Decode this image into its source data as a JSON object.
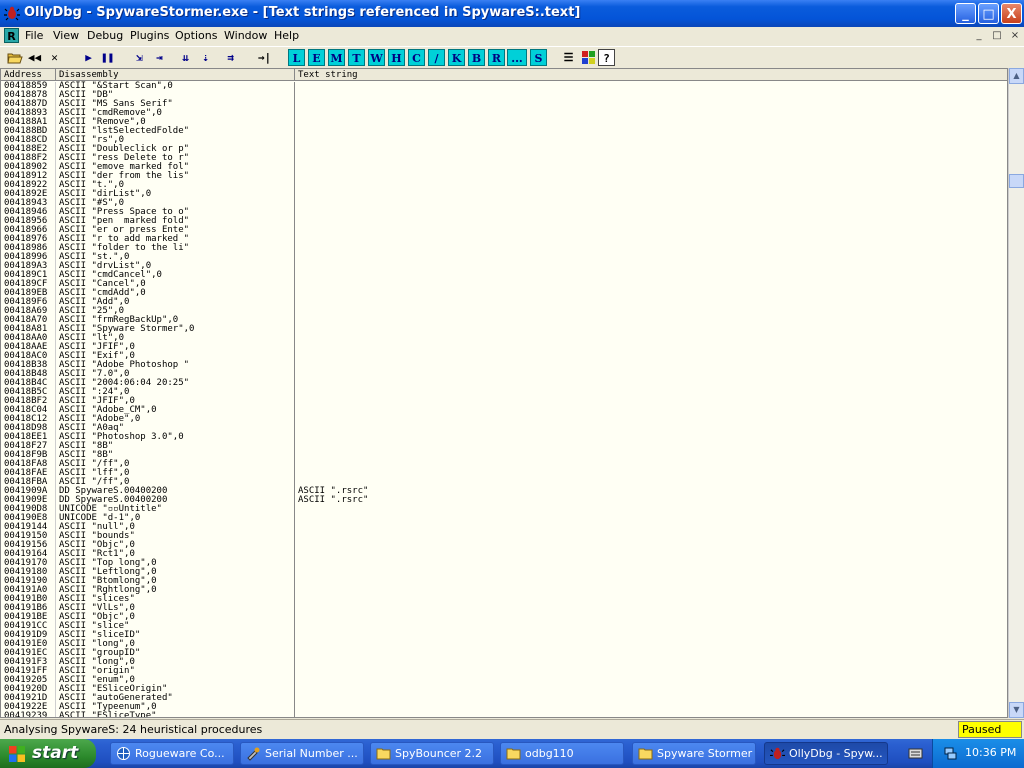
{
  "window": {
    "title": "OllyDbg - SpywareStormer.exe - [Text strings referenced in SpywareS:.text]",
    "controls": {
      "minimize": "_",
      "maximize": "□",
      "close": "X"
    }
  },
  "menu": {
    "items": [
      "File",
      "View",
      "Debug",
      "Plugins",
      "Options",
      "Window",
      "Help"
    ],
    "mdi_controls": [
      "_",
      "□",
      "×"
    ]
  },
  "toolbar": {
    "letters": [
      "L",
      "E",
      "M",
      "T",
      "W",
      "H",
      "C",
      "/",
      "K",
      "B",
      "R",
      "...",
      "S"
    ],
    "icons": [
      "open-icon",
      "restart-icon",
      "close-program-icon",
      "run-icon",
      "pause-icon",
      "step-into-icon",
      "step-over-icon",
      "trace-into-icon",
      "trace-over-icon",
      "execute-till-return-icon",
      "goto-icon",
      "list-icon",
      "colors-icon",
      "help-icon"
    ]
  },
  "columns": {
    "address": "Address",
    "disassembly": "Disassembly",
    "text": "Text string"
  },
  "rows": [
    {
      "addr": "00418859",
      "dis": "ASCII \"&Start Scan\",0",
      "txt": ""
    },
    {
      "addr": "00418878",
      "dis": "ASCII \"DB\"",
      "txt": ""
    },
    {
      "addr": "0041887D",
      "dis": "ASCII \"MS Sans Serif\"",
      "txt": ""
    },
    {
      "addr": "00418893",
      "dis": "ASCII \"cmdRemove\",0",
      "txt": ""
    },
    {
      "addr": "004188A1",
      "dis": "ASCII \"Remove\",0",
      "txt": ""
    },
    {
      "addr": "004188BD",
      "dis": "ASCII \"lstSelectedFolde\"",
      "txt": ""
    },
    {
      "addr": "004188CD",
      "dis": "ASCII \"rs\",0",
      "txt": ""
    },
    {
      "addr": "004188E2",
      "dis": "ASCII \"Doubleclick or p\"",
      "txt": ""
    },
    {
      "addr": "004188F2",
      "dis": "ASCII \"ress Delete to r\"",
      "txt": ""
    },
    {
      "addr": "00418902",
      "dis": "ASCII \"emove marked fol\"",
      "txt": ""
    },
    {
      "addr": "00418912",
      "dis": "ASCII \"der from the lis\"",
      "txt": ""
    },
    {
      "addr": "00418922",
      "dis": "ASCII \"t.\",0",
      "txt": ""
    },
    {
      "addr": "0041892E",
      "dis": "ASCII \"dirList\",0",
      "txt": ""
    },
    {
      "addr": "00418943",
      "dis": "ASCII \"#S\",0",
      "txt": ""
    },
    {
      "addr": "00418946",
      "dis": "ASCII \"Press Space to o\"",
      "txt": ""
    },
    {
      "addr": "00418956",
      "dis": "ASCII \"pen  marked fold\"",
      "txt": ""
    },
    {
      "addr": "00418966",
      "dis": "ASCII \"er or press Ente\"",
      "txt": ""
    },
    {
      "addr": "00418976",
      "dis": "ASCII \"r to add marked \"",
      "txt": ""
    },
    {
      "addr": "00418986",
      "dis": "ASCII \"folder to the li\"",
      "txt": ""
    },
    {
      "addr": "00418996",
      "dis": "ASCII \"st.\",0",
      "txt": ""
    },
    {
      "addr": "004189A3",
      "dis": "ASCII \"drvList\",0",
      "txt": ""
    },
    {
      "addr": "004189C1",
      "dis": "ASCII \"cmdCancel\",0",
      "txt": ""
    },
    {
      "addr": "004189CF",
      "dis": "ASCII \"Cancel\",0",
      "txt": ""
    },
    {
      "addr": "004189EB",
      "dis": "ASCII \"cmdAdd\",0",
      "txt": ""
    },
    {
      "addr": "004189F6",
      "dis": "ASCII \"Add\",0",
      "txt": ""
    },
    {
      "addr": "00418A69",
      "dis": "ASCII \"25\",0",
      "txt": ""
    },
    {
      "addr": "00418A70",
      "dis": "ASCII \"frmRegBackUp\",0",
      "txt": ""
    },
    {
      "addr": "00418A81",
      "dis": "ASCII \"Spyware Stormer\",0",
      "txt": ""
    },
    {
      "addr": "00418AA0",
      "dis": "ASCII \"lt\",0",
      "txt": ""
    },
    {
      "addr": "00418AAE",
      "dis": "ASCII \"JFIF\",0",
      "txt": ""
    },
    {
      "addr": "00418AC0",
      "dis": "ASCII \"Exif\",0",
      "txt": ""
    },
    {
      "addr": "00418B38",
      "dis": "ASCII \"Adobe Photoshop \"",
      "txt": ""
    },
    {
      "addr": "00418B48",
      "dis": "ASCII \"7.0\",0",
      "txt": ""
    },
    {
      "addr": "00418B4C",
      "dis": "ASCII \"2004:06:04 20:25\"",
      "txt": ""
    },
    {
      "addr": "00418B5C",
      "dis": "ASCII \":24\",0",
      "txt": ""
    },
    {
      "addr": "00418BF2",
      "dis": "ASCII \"JFIF\",0",
      "txt": ""
    },
    {
      "addr": "00418C04",
      "dis": "ASCII \"Adobe_CM\",0",
      "txt": ""
    },
    {
      "addr": "00418C12",
      "dis": "ASCII \"Adobe\",0",
      "txt": ""
    },
    {
      "addr": "00418D98",
      "dis": "ASCII \"A0aq\"",
      "txt": ""
    },
    {
      "addr": "00418EE1",
      "dis": "ASCII \"Photoshop 3.0\",0",
      "txt": ""
    },
    {
      "addr": "00418F27",
      "dis": "ASCII \"8B\"",
      "txt": ""
    },
    {
      "addr": "00418F9B",
      "dis": "ASCII \"8B\"",
      "txt": ""
    },
    {
      "addr": "00418FA8",
      "dis": "ASCII \"/ff\",0",
      "txt": ""
    },
    {
      "addr": "00418FAE",
      "dis": "ASCII \"lff\",0",
      "txt": ""
    },
    {
      "addr": "00418FBA",
      "dis": "ASCII \"/ff\",0",
      "txt": ""
    },
    {
      "addr": "0041909A",
      "dis": "DD SpywareS.00400200",
      "txt": "ASCII \".rsrc\""
    },
    {
      "addr": "0041909E",
      "dis": "DD SpywareS.00400200",
      "txt": "ASCII \".rsrc\""
    },
    {
      "addr": "004190D8",
      "dis": "UNICODE \"▫▫Untitle\"",
      "txt": ""
    },
    {
      "addr": "004190E8",
      "dis": "UNICODE \"d-1\",0",
      "txt": ""
    },
    {
      "addr": "00419144",
      "dis": "ASCII \"null\",0",
      "txt": ""
    },
    {
      "addr": "00419150",
      "dis": "ASCII \"bounds\"",
      "txt": ""
    },
    {
      "addr": "00419156",
      "dis": "ASCII \"Objc\",0",
      "txt": ""
    },
    {
      "addr": "00419164",
      "dis": "ASCII \"Rct1\",0",
      "txt": ""
    },
    {
      "addr": "00419170",
      "dis": "ASCII \"Top long\",0",
      "txt": ""
    },
    {
      "addr": "00419180",
      "dis": "ASCII \"Leftlong\",0",
      "txt": ""
    },
    {
      "addr": "00419190",
      "dis": "ASCII \"Btomlong\",0",
      "txt": ""
    },
    {
      "addr": "004191A0",
      "dis": "ASCII \"Rghtlong\",0",
      "txt": ""
    },
    {
      "addr": "004191B0",
      "dis": "ASCII \"slices\"",
      "txt": ""
    },
    {
      "addr": "004191B6",
      "dis": "ASCII \"VlLs\",0",
      "txt": ""
    },
    {
      "addr": "004191BE",
      "dis": "ASCII \"Objc\",0",
      "txt": ""
    },
    {
      "addr": "004191CC",
      "dis": "ASCII \"slice\"",
      "txt": ""
    },
    {
      "addr": "004191D9",
      "dis": "ASCII \"sliceID\"",
      "txt": ""
    },
    {
      "addr": "004191E0",
      "dis": "ASCII \"long\",0",
      "txt": ""
    },
    {
      "addr": "004191EC",
      "dis": "ASCII \"groupID\"",
      "txt": ""
    },
    {
      "addr": "004191F3",
      "dis": "ASCII \"long\",0",
      "txt": ""
    },
    {
      "addr": "004191FF",
      "dis": "ASCII \"origin\"",
      "txt": ""
    },
    {
      "addr": "00419205",
      "dis": "ASCII \"enum\",0",
      "txt": ""
    },
    {
      "addr": "0041920D",
      "dis": "ASCII \"ESliceOrigin\"",
      "txt": ""
    },
    {
      "addr": "0041921D",
      "dis": "ASCII \"autoGenerated\"",
      "txt": ""
    },
    {
      "addr": "0041922E",
      "dis": "ASCII \"Typeenum\",0",
      "txt": ""
    },
    {
      "addr": "00419239",
      "dis": "ASCII \"ESliceType\"",
      "txt": ""
    }
  ],
  "status": {
    "text": "Analysing SpywareS: 24 heuristical procedures",
    "state": "Paused"
  },
  "taskbar": {
    "start": "start",
    "tasks": [
      "Rogueware Co...",
      "Serial Number ...",
      "SpyBouncer 2.2",
      "odbg110",
      "Spyware Stormer",
      "OllyDbg - Spyw..."
    ],
    "clock": "10:36 PM"
  }
}
